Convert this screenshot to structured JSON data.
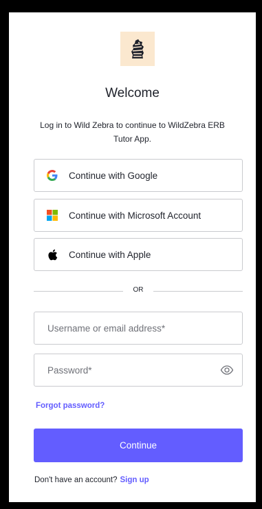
{
  "header": {
    "logo_icon": "zebra-logo-icon",
    "title": "Welcome",
    "subtitle": "Log in to Wild Zebra to continue to WildZebra ERB Tutor App."
  },
  "social": [
    {
      "label": "Continue with Google",
      "icon": "google-icon"
    },
    {
      "label": "Continue with Microsoft Account",
      "icon": "microsoft-icon"
    },
    {
      "label": "Continue with Apple",
      "icon": "apple-icon"
    }
  ],
  "divider": {
    "label": "OR"
  },
  "form": {
    "username_placeholder": "Username or email address*",
    "username_value": "",
    "password_placeholder": "Password*",
    "password_value": "",
    "show_password_icon": "eye-icon",
    "forgot_label": "Forgot password?",
    "continue_label": "Continue"
  },
  "footer": {
    "prompt": "Don't have an account?",
    "signup_label": "Sign up"
  },
  "colors": {
    "accent": "#635dff",
    "border": "#c9cace",
    "text": "#1e212a",
    "logo_bg": "#fbe8cf"
  }
}
